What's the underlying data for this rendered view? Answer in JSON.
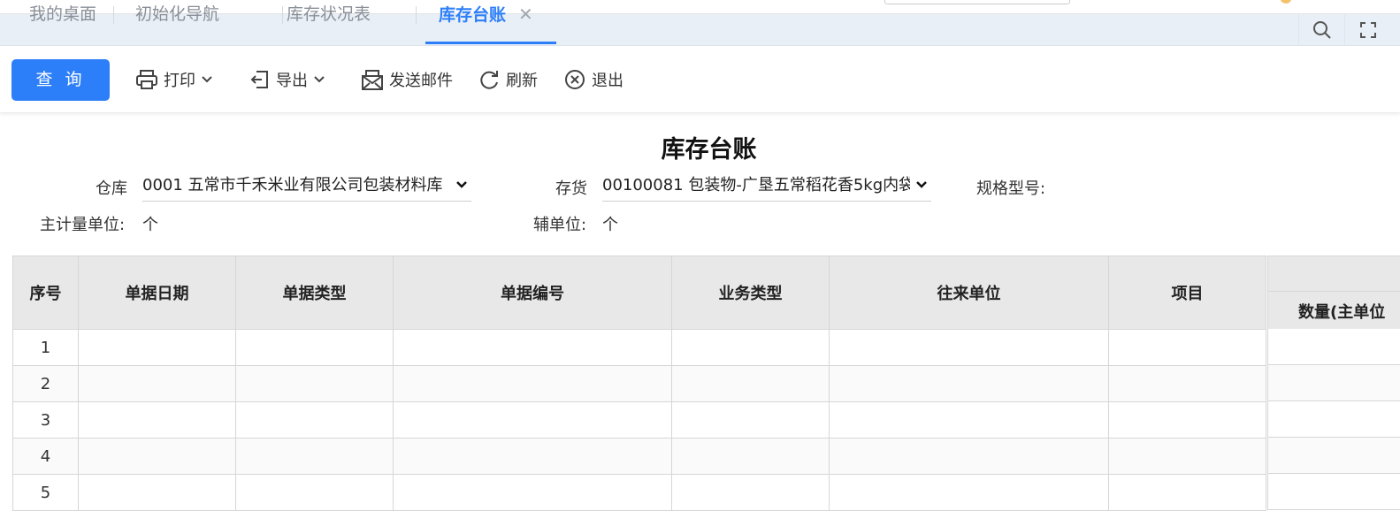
{
  "tabs": [
    {
      "label": "我的桌面"
    },
    {
      "label": "初始化导航"
    },
    {
      "label": "库存状况表"
    },
    {
      "label": "库存台账",
      "active": true,
      "close": "✕"
    }
  ],
  "toolbar": {
    "query_label": "查 询",
    "print_label": "打印",
    "export_label": "导出",
    "email_label": "发送邮件",
    "refresh_label": "刷新",
    "exit_label": "退出"
  },
  "report": {
    "title": "库存台账",
    "warehouse_label": "仓库",
    "warehouse_value": "0001 五常市千禾米业有限公司包装材料库",
    "inventory_label": "存货",
    "inventory_value": "00100081 包装物-广垦五常稻花香5kg内袋",
    "spec_label": "规格型号:",
    "main_unit_label": "主计量单位:",
    "main_unit_value": "个",
    "aux_unit_label": "辅单位:",
    "aux_unit_value": "个"
  },
  "table": {
    "columns": [
      "序号",
      "单据日期",
      "单据类型",
      "单据编号",
      "业务类型",
      "往来单位",
      "项目"
    ],
    "last_column_sub": "数量(主单位",
    "rows": [
      "1",
      "2",
      "3",
      "4",
      "5"
    ]
  },
  "colors": {
    "accent": "#2d7ff9",
    "header_bg": "#e8e8e8",
    "tabbar_bg": "#e9eff7"
  }
}
